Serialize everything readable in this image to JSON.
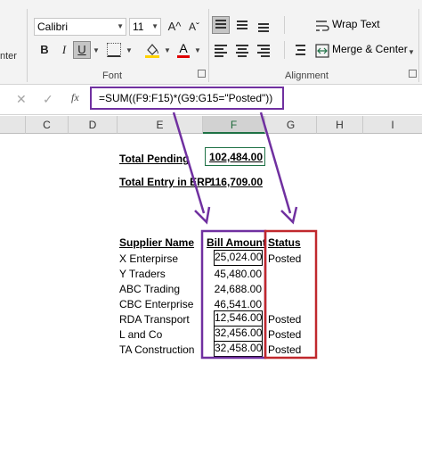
{
  "ribbon": {
    "font_name": "Calibri",
    "font_size": "11",
    "grow_font": "A^",
    "shrink_font": "Aˇ",
    "bold": "B",
    "italic": "I",
    "underline": "U",
    "font_color_letter": "A",
    "left_partial_label": "nter",
    "font_group_label": "Font",
    "alignment_group_label": "Alignment",
    "wrap_text_label": "Wrap Text",
    "merge_center_label": "Merge & Center",
    "fill_color": "#ffd200",
    "font_color": "#e00000"
  },
  "formula_bar": {
    "cancel": "✕",
    "enter": "✓",
    "fx": "fx",
    "formula": "=SUM((F9:F15)*(G9:G15=\"Posted\"))"
  },
  "columns": [
    "C",
    "D",
    "E",
    "F",
    "G",
    "H",
    "I"
  ],
  "active_column": "F",
  "sheet": {
    "total_pending_label": "Total Pending",
    "total_pending_value": "102,484.00",
    "total_entry_label": "Total Entry in ERP",
    "total_entry_value": "116,709.00",
    "headers": {
      "supplier": "Supplier Name",
      "amount": "Bill Amount",
      "status": "Status"
    },
    "rows": [
      {
        "supplier": "X Enterpirse",
        "amount": "25,024.00",
        "status": "Posted"
      },
      {
        "supplier": "Y Traders",
        "amount": "45,480.00",
        "status": ""
      },
      {
        "supplier": "ABC Trading",
        "amount": "24,688.00",
        "status": ""
      },
      {
        "supplier": "CBC Enterprise",
        "amount": "46,541.00",
        "status": ""
      },
      {
        "supplier": "RDA Transport",
        "amount": "12,546.00",
        "status": "Posted"
      },
      {
        "supplier": "L and Co",
        "amount": "32,456.00",
        "status": "Posted"
      },
      {
        "supplier": "TA Construction",
        "amount": "32,458.00",
        "status": "Posted"
      }
    ]
  },
  "annotation_colors": {
    "formula_box": "#7030a0",
    "amount_box": "#7030a0",
    "status_box": "#c0282d"
  }
}
